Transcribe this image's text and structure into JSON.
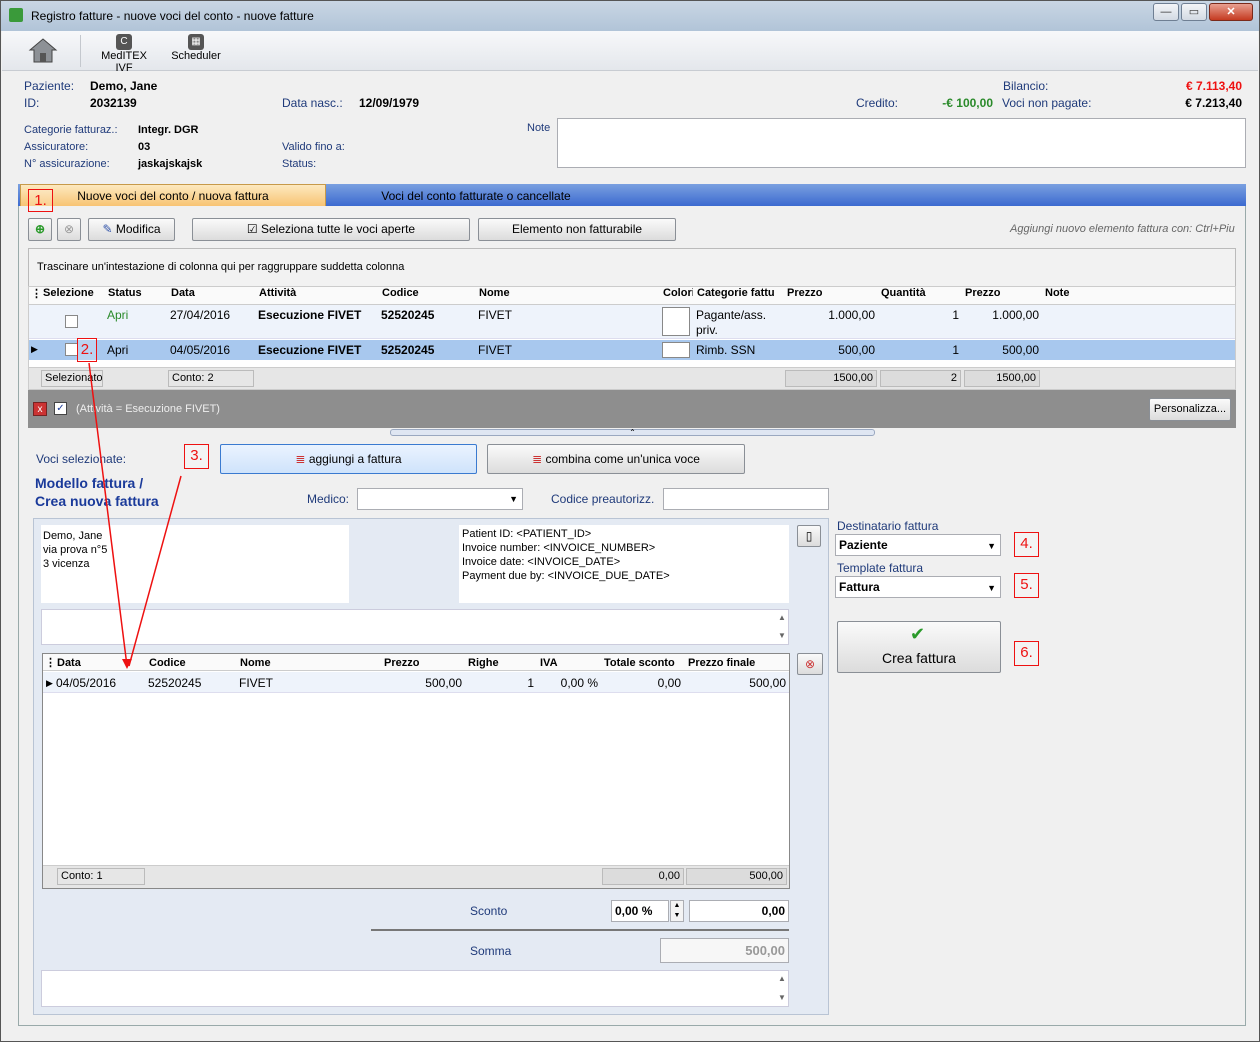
{
  "window": {
    "title": "Registro fatture - nuove voci del conto - nuove fatture"
  },
  "toolbar": {
    "home_label": "",
    "meditex_label": "MedITEX IVF",
    "scheduler_label": "Scheduler"
  },
  "patient": {
    "paziente_label": "Paziente:",
    "paziente_value": "Demo, Jane",
    "id_label": "ID:",
    "id_value": "2032139",
    "data_nasc_label": "Data nasc.:",
    "data_nasc_value": "12/09/1979",
    "bilancio_label": "Bilancio:",
    "bilancio_value": "€ 7.113,40",
    "credito_label": "Credito:",
    "credito_value": "-€ 100,00",
    "voci_np_label": "Voci non pagate:",
    "voci_np_value": "€ 7.213,40",
    "categorie_label": "Categorie fatturaz.:",
    "categorie_value": "Integr. DGR",
    "assicuratore_label": "Assicuratore:",
    "assicuratore_value": "03",
    "n_assic_label": "N° assicurazione:",
    "n_assic_value": "jaskajskajsk",
    "valido_label": "Valido fino a:",
    "status_label": "Status:",
    "note_label": "Note"
  },
  "tabs": [
    {
      "label": "Nuove voci del conto / nuova fattura"
    },
    {
      "label": "Voci del conto fatturate o cancellate"
    }
  ],
  "actions": {
    "modifica": "Modifica",
    "seleziona_tutte": "Seleziona tutte le voci aperte",
    "non_fatturabile": "Elemento non fatturabile",
    "hint": "Aggiungi nuovo elemento fattura con: Ctrl+Piu"
  },
  "grid": {
    "group_hint": "Trascinare un'intestazione di colonna qui per raggruppare suddetta colonna",
    "columns": [
      "Selezione",
      "Status",
      "Data",
      "Attività",
      "Codice",
      "Nome",
      "Colori",
      "Categorie fattu",
      "Prezzo",
      "Quantità",
      "Prezzo",
      "Note"
    ],
    "rows": [
      {
        "status": "Apri",
        "data": "27/04/2016",
        "attivita": "Esecuzione FIVET",
        "codice": "52520245",
        "nome": "FIVET",
        "categoria": "Pagante/ass.",
        "categoria2": "priv.",
        "prezzo": "1.000,00",
        "quantita": "1",
        "prezzo_tot": "1.000,00"
      },
      {
        "status": "Apri",
        "data": "04/05/2016",
        "attivita": "Esecuzione FIVET",
        "codice": "52520245",
        "nome": "FIVET",
        "categoria": "Rimb. SSN",
        "categoria2": "",
        "prezzo": "500,00",
        "quantita": "1",
        "prezzo_tot": "500,00"
      }
    ],
    "footer": {
      "selezionato": "Selezionato",
      "conto": "Conto: 2",
      "prezzo": "1500,00",
      "quantita": "2",
      "prezzo_tot": "1500,00"
    },
    "filter_text": "(Attività = Esecuzione FIVET)",
    "personalizza": "Personalizza..."
  },
  "selected": {
    "label": "Voci selezionate:",
    "aggiungi": "aggiungi a fattura",
    "combina": "combina come un'unica voce"
  },
  "invoice": {
    "title_line1": "Modello fattura /",
    "title_line2": "Crea nuova fattura",
    "medico_label": "Medico:",
    "codice_label": "Codice preautorizz.",
    "address": [
      "Demo, Jane",
      "via prova n°5",
      "3 vicenza"
    ],
    "info": [
      "Patient ID: <PATIENT_ID>",
      "Invoice number: <INVOICE_NUMBER>",
      "Invoice date: <INVOICE_DATE>",
      "Payment due by: <INVOICE_DUE_DATE>"
    ],
    "columns": [
      "Data",
      "Codice",
      "Nome",
      "Prezzo",
      "Righe",
      "IVA",
      "Totale sconto",
      "Prezzo finale"
    ],
    "row": {
      "data": "04/05/2016",
      "codice": "52520245",
      "nome": "FIVET",
      "prezzo": "500,00",
      "righe": "1",
      "iva": "0,00 %",
      "sconto": "0,00",
      "finale": "500,00"
    },
    "footer": {
      "conto": "Conto: 1",
      "sconto": "0,00",
      "finale": "500,00"
    },
    "sconto_label": "Sconto",
    "sconto_pct": "0,00 %",
    "sconto_val": "0,00",
    "somma_label": "Somma",
    "somma_val": "500,00"
  },
  "right_panel": {
    "destinatario_label": "Destinatario fattura",
    "destinatario_value": "Paziente",
    "template_label": "Template fattura",
    "template_value": "Fattura",
    "crea": "Crea fattura"
  },
  "markers": [
    "1.",
    "2.",
    "3.",
    "4.",
    "5.",
    "6."
  ],
  "colors": {
    "accent_tab": "#f9c97a",
    "selected_row": "#a8c8ee",
    "credit_green": "#2a8a2a",
    "balance_red": "#e11"
  }
}
